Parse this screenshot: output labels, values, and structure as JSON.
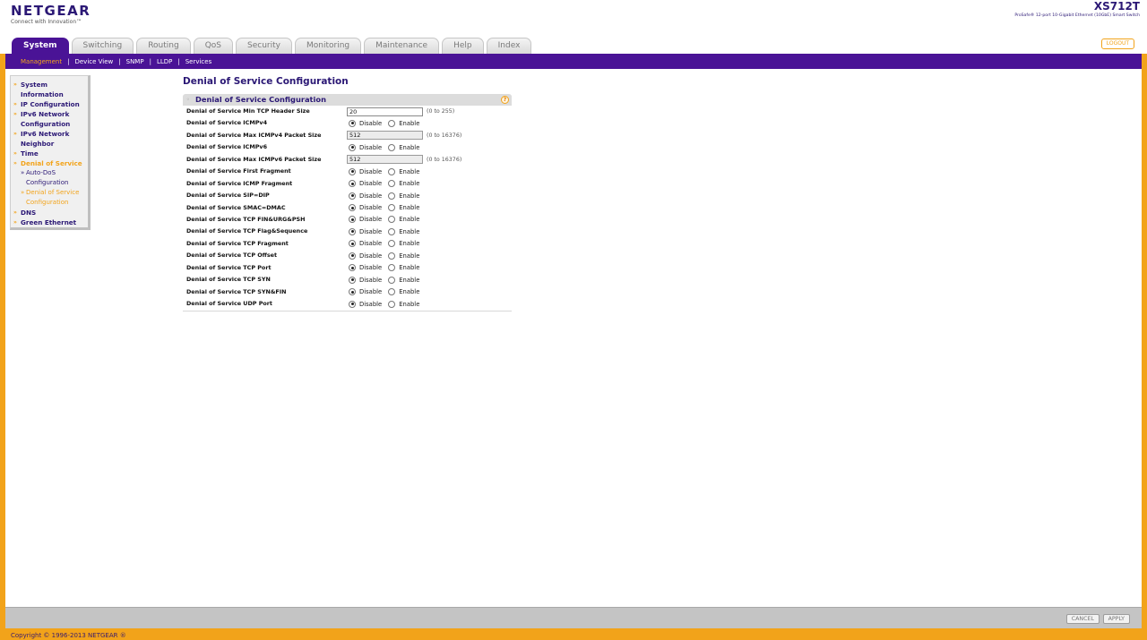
{
  "brand": {
    "name": "NETGEAR",
    "tagline": "Connect with Innovation™"
  },
  "device": {
    "model": "XS712T",
    "description": "ProSafe® 12-port 10-Gigabit Ethernet (10GbE) Smart Switch"
  },
  "tabs": [
    {
      "label": "System",
      "active": true
    },
    {
      "label": "Switching"
    },
    {
      "label": "Routing"
    },
    {
      "label": "QoS"
    },
    {
      "label": "Security"
    },
    {
      "label": "Monitoring"
    },
    {
      "label": "Maintenance"
    },
    {
      "label": "Help"
    },
    {
      "label": "Index"
    }
  ],
  "logout_label": "LOGOUT",
  "subnav": [
    {
      "label": "Management",
      "active": true
    },
    {
      "label": "Device View"
    },
    {
      "label": "SNMP"
    },
    {
      "label": "LLDP"
    },
    {
      "label": "Services"
    }
  ],
  "leftnav": {
    "system": "System",
    "information": "Information",
    "ip_config": "IP Configuration",
    "ipv6_network": "IPv6 Network",
    "configuration": "Configuration",
    "ipv6_network2": "IPv6 Network",
    "neighbor": "Neighbor",
    "time": "Time",
    "dos": "Denial of Service",
    "auto_dos": "Auto-DoS",
    "auto_dos_config": "Configuration",
    "dos_sub": "Denial of Service",
    "dos_sub_config": "Configuration",
    "dns": "DNS",
    "green_ethernet": "Green Ethernet"
  },
  "page_title": "Denial of Service Configuration",
  "panel_title": "Denial of Service Configuration",
  "radio_labels": {
    "disable": "Disable",
    "enable": "Enable"
  },
  "fields": {
    "min_tcp_header": {
      "label": "Denial of Service Min TCP Header Size",
      "value": "20",
      "range": "(0 to 255)"
    },
    "icmpv4": {
      "label": "Denial of Service ICMPv4",
      "selected": "Disable"
    },
    "max_icmpv4": {
      "label": "Denial of Service Max ICMPv4 Packet Size",
      "value": "512",
      "range": "(0 to 16376)"
    },
    "icmpv6": {
      "label": "Denial of Service ICMPv6",
      "selected": "Disable"
    },
    "max_icmpv6": {
      "label": "Denial of Service Max ICMPv6 Packet Size",
      "value": "512",
      "range": "(0 to 16376)"
    },
    "first_fragment": {
      "label": "Denial of Service First Fragment",
      "selected": "Disable"
    },
    "icmp_fragment": {
      "label": "Denial of Service ICMP Fragment",
      "selected": "Disable"
    },
    "sip_dip": {
      "label": "Denial of Service SIP=DIP",
      "selected": "Disable"
    },
    "smac_dmac": {
      "label": "Denial of Service SMAC=DMAC",
      "selected": "Disable"
    },
    "tcp_fin_urg_psh": {
      "label": "Denial of Service TCP FIN&URG&PSH",
      "selected": "Disable"
    },
    "tcp_flag_seq": {
      "label": "Denial of Service TCP Flag&Sequence",
      "selected": "Disable"
    },
    "tcp_fragment": {
      "label": "Denial of Service TCP Fragment",
      "selected": "Disable"
    },
    "tcp_offset": {
      "label": "Denial of Service TCP Offset",
      "selected": "Disable"
    },
    "tcp_port": {
      "label": "Denial of Service TCP Port",
      "selected": "Disable"
    },
    "tcp_syn": {
      "label": "Denial of Service TCP SYN",
      "selected": "Disable"
    },
    "tcp_syn_fin": {
      "label": "Denial of Service TCP SYN&FIN",
      "selected": "Disable"
    },
    "udp_port": {
      "label": "Denial of Service UDP Port",
      "selected": "Disable"
    }
  },
  "buttons": {
    "cancel": "CANCEL",
    "apply": "APPLY"
  },
  "copyright": "Copyright © 1996-2013 NETGEAR ®",
  "colors": {
    "purple": "#4a1396",
    "orange": "#f2a31a"
  }
}
